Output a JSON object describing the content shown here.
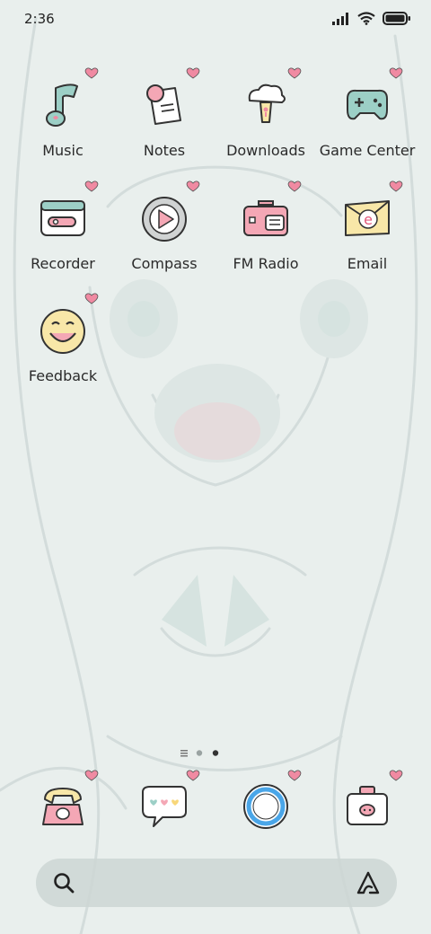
{
  "status_bar": {
    "time": "2:36",
    "icons": [
      "signal-icon",
      "wifi-icon",
      "battery-icon"
    ]
  },
  "apps": [
    {
      "label": "Music",
      "icon": "music-note-icon"
    },
    {
      "label": "Notes",
      "icon": "notes-icon"
    },
    {
      "label": "Downloads",
      "icon": "downloads-icon"
    },
    {
      "label": "Game Center",
      "icon": "gamepad-icon"
    },
    {
      "label": "Recorder",
      "icon": "recorder-icon"
    },
    {
      "label": "Compass",
      "icon": "compass-icon"
    },
    {
      "label": "FM Radio",
      "icon": "radio-icon"
    },
    {
      "label": "Email",
      "icon": "email-icon"
    },
    {
      "label": "Feedback",
      "icon": "smiley-icon"
    }
  ],
  "pager": {
    "pages": 2,
    "current": 2,
    "leading": "menu-icon"
  },
  "dock": [
    {
      "name": "phone",
      "icon": "phone-icon"
    },
    {
      "name": "messages",
      "icon": "message-icon"
    },
    {
      "name": "browser",
      "icon": "browser-ring-icon"
    },
    {
      "name": "camera",
      "icon": "camera-icon"
    }
  ],
  "search_bar": {
    "left_icon": "search-icon",
    "right_icon": "assistant-icon"
  },
  "colors": {
    "background": "#e9efed",
    "heart": "#f08aa2",
    "mint": "#9ccfc6",
    "pink": "#f4a7b5",
    "yellow": "#f8e7a8"
  }
}
